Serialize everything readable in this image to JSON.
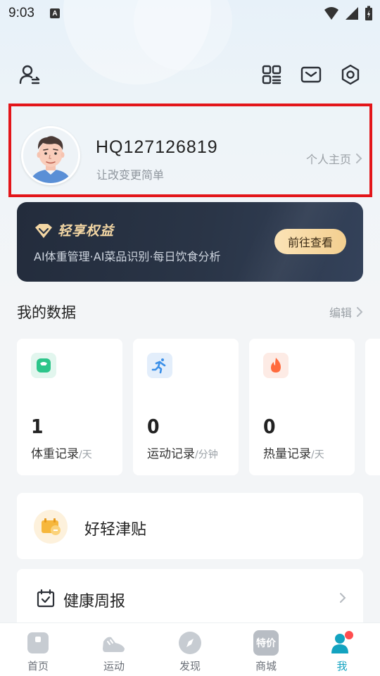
{
  "status_bar": {
    "time": "9:03",
    "notification_badge": "A"
  },
  "profile": {
    "username": "HQ127126819",
    "slogan": "让改变更简单",
    "home_link": "个人主页"
  },
  "vip": {
    "title": "轻享权益",
    "description": "AI体重管理·AI菜品识别·每日饮食分析",
    "button": "前往查看"
  },
  "my_data": {
    "title": "我的数据",
    "edit": "编辑",
    "cards": [
      {
        "value": "1",
        "label": "体重记录",
        "unit": "/天",
        "icon": "scale-icon",
        "color": "#2cc58a"
      },
      {
        "value": "0",
        "label": "运动记录",
        "unit": "/分钟",
        "icon": "running-icon",
        "color": "#3a8fe8"
      },
      {
        "value": "0",
        "label": "热量记录",
        "unit": "/天",
        "icon": "flame-icon",
        "color": "#ff6a3d"
      }
    ]
  },
  "list": {
    "subsidy": "好轻津贴",
    "health_report": "健康周报"
  },
  "nav": {
    "items": [
      {
        "label": "首页",
        "icon": "home-icon"
      },
      {
        "label": "运动",
        "icon": "shoe-icon"
      },
      {
        "label": "发现",
        "icon": "compass-icon"
      },
      {
        "label": "商城",
        "icon": "shop-icon",
        "badge": "特价"
      },
      {
        "label": "我",
        "icon": "profile-icon",
        "active": true
      }
    ]
  },
  "colors": {
    "accent": "#13a3c0",
    "highlight_border": "#e3151a",
    "vip_gold": "#f4d7a4"
  }
}
